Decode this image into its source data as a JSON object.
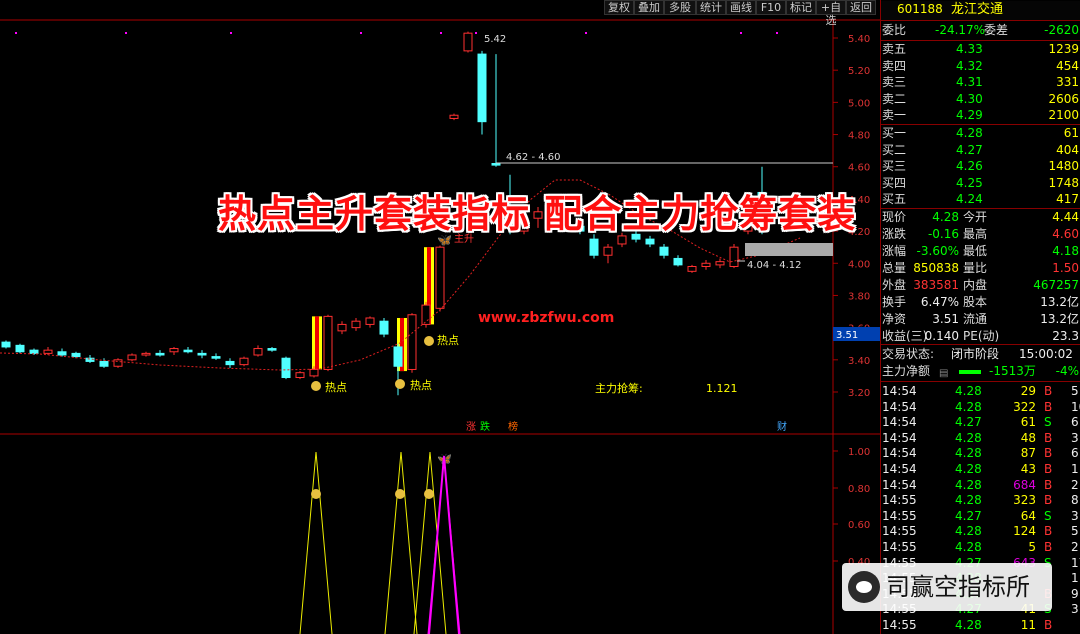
{
  "toolbar": {
    "buttons": [
      "复权",
      "叠加",
      "多股",
      "统计",
      "画线",
      "F10",
      "标记",
      "+自选",
      "返回"
    ]
  },
  "stock": {
    "code": "601188",
    "name": "龙江交通"
  },
  "order_book": {
    "weibi_label": "委比",
    "weibi": "-24.17%",
    "weicha_label": "委差",
    "weicha": "-2620",
    "asks": [
      {
        "label": "卖五",
        "price": "4.33",
        "vol": "1239"
      },
      {
        "label": "卖四",
        "price": "4.32",
        "vol": "454"
      },
      {
        "label": "卖三",
        "price": "4.31",
        "vol": "331"
      },
      {
        "label": "卖二",
        "price": "4.30",
        "vol": "2606"
      },
      {
        "label": "卖一",
        "price": "4.29",
        "vol": "2100"
      }
    ],
    "bids": [
      {
        "label": "买一",
        "price": "4.28",
        "vol": "61"
      },
      {
        "label": "买二",
        "price": "4.27",
        "vol": "404"
      },
      {
        "label": "买三",
        "price": "4.26",
        "vol": "1480"
      },
      {
        "label": "买四",
        "price": "4.25",
        "vol": "1748"
      },
      {
        "label": "买五",
        "price": "4.24",
        "vol": "417"
      }
    ]
  },
  "quote": [
    {
      "l1": "现价",
      "v1": "4.28",
      "l2": "今开",
      "v2": "4.44",
      "c1": "grn",
      "c2": "yel"
    },
    {
      "l1": "涨跌",
      "v1": "-0.16",
      "l2": "最高",
      "v2": "4.60",
      "c1": "grn",
      "c2": "red"
    },
    {
      "l1": "涨幅",
      "v1": "-3.60%",
      "l2": "最低",
      "v2": "4.18",
      "c1": "grn",
      "c2": "grn"
    },
    {
      "l1": "总量",
      "v1": "850838",
      "l2": "量比",
      "v2": "1.50",
      "c1": "yel",
      "c2": "red"
    },
    {
      "l1": "外盘",
      "v1": "383581",
      "l2": "内盘",
      "v2": "467257",
      "c1": "red",
      "c2": "grn"
    },
    {
      "l1": "换手",
      "v1": "6.47%",
      "l2": "股本",
      "v2": "13.2亿",
      "c1": "wht",
      "c2": "wht"
    },
    {
      "l1": "净资",
      "v1": "3.51",
      "l2": "流通",
      "v2": "13.2亿",
      "c1": "wht",
      "c2": "wht"
    },
    {
      "l1": "收益(三)",
      "v1": "0.140",
      "l2": "PE(动)",
      "v2": "23.3",
      "c1": "wht",
      "c2": "wht"
    }
  ],
  "trade_status": {
    "label": "交易状态:",
    "value": "闭市阶段",
    "time": "15:00:02"
  },
  "net_flow": {
    "label": "主力净额",
    "value": "-1513万",
    "pct": "-4%"
  },
  "ticks": [
    {
      "t": "14:54",
      "p": "4.28",
      "v": "29",
      "s": "B",
      "n": "5"
    },
    {
      "t": "14:54",
      "p": "4.28",
      "v": "322",
      "s": "B",
      "n": "10"
    },
    {
      "t": "14:54",
      "p": "4.27",
      "v": "61",
      "s": "S",
      "n": "6"
    },
    {
      "t": "14:54",
      "p": "4.28",
      "v": "48",
      "s": "B",
      "n": "3"
    },
    {
      "t": "14:54",
      "p": "4.28",
      "v": "87",
      "s": "B",
      "n": "6"
    },
    {
      "t": "14:54",
      "p": "4.28",
      "v": "43",
      "s": "B",
      "n": "1"
    },
    {
      "t": "14:54",
      "p": "4.28",
      "v": "684",
      "s": "B",
      "n": "2"
    },
    {
      "t": "14:55",
      "p": "4.28",
      "v": "323",
      "s": "B",
      "n": "8"
    },
    {
      "t": "14:55",
      "p": "4.27",
      "v": "64",
      "s": "S",
      "n": "3"
    },
    {
      "t": "14:55",
      "p": "4.28",
      "v": "124",
      "s": "B",
      "n": "5"
    },
    {
      "t": "14:55",
      "p": "4.28",
      "v": "5",
      "s": "B",
      "n": "2"
    },
    {
      "t": "14:55",
      "p": "4.27",
      "v": "643",
      "s": "S",
      "n": "17"
    },
    {
      "t": "14:55",
      "p": "4.28",
      "v": "",
      "s": "",
      "n": "1"
    },
    {
      "t": "14:55",
      "p": "4.27",
      "v": "",
      "s": "B",
      "n": "9"
    },
    {
      "t": "14:55",
      "p": "4.27",
      "v": "41",
      "s": "S",
      "n": "3"
    },
    {
      "t": "14:55",
      "p": "4.28",
      "v": "11",
      "s": "B",
      "n": ""
    }
  ],
  "banner": "热点主升套装指标 配合主力抢筹套装",
  "url": "www.zbzfwu.com",
  "watermark": "司赢空指标所",
  "chart_labels": {
    "high_label": "5.42",
    "range1": "4.62 - 4.60",
    "range2": "4.04 - 4.12",
    "hot1": "热点",
    "hot2": "热点",
    "hot3": "热点",
    "rise": "主升",
    "indicator_name": "主力抢筹:",
    "indicator_value": "1.121",
    "marker_zhang": "涨",
    "marker_die": "跌",
    "marker_bang": "榜",
    "marker_cai": "财",
    "price_tag": "3.51"
  },
  "chart_data": {
    "type": "candlestick",
    "yticks_main": [
      "5.40",
      "5.20",
      "5.00",
      "4.80",
      "4.60",
      "4.40",
      "4.20",
      "4.00",
      "3.80",
      "3.60",
      "3.40",
      "3.20"
    ],
    "yticks_sub": [
      "1.00",
      "0.80",
      "0.60",
      "0.40"
    ],
    "candles": [
      {
        "o": 3.51,
        "c": 3.48,
        "h": 3.52,
        "l": 3.47
      },
      {
        "o": 3.49,
        "c": 3.45,
        "h": 3.5,
        "l": 3.44
      },
      {
        "o": 3.46,
        "c": 3.44,
        "h": 3.47,
        "l": 3.43
      },
      {
        "o": 3.44,
        "c": 3.46,
        "h": 3.48,
        "l": 3.43
      },
      {
        "o": 3.45,
        "c": 3.43,
        "h": 3.47,
        "l": 3.42
      },
      {
        "o": 3.44,
        "c": 3.42,
        "h": 3.45,
        "l": 3.41
      },
      {
        "o": 3.41,
        "c": 3.39,
        "h": 3.43,
        "l": 3.38
      },
      {
        "o": 3.39,
        "c": 3.36,
        "h": 3.41,
        "l": 3.35
      },
      {
        "o": 3.36,
        "c": 3.4,
        "h": 3.41,
        "l": 3.35
      },
      {
        "o": 3.4,
        "c": 3.43,
        "h": 3.44,
        "l": 3.39
      },
      {
        "o": 3.43,
        "c": 3.44,
        "h": 3.45,
        "l": 3.42
      },
      {
        "o": 3.44,
        "c": 3.43,
        "h": 3.46,
        "l": 3.42
      },
      {
        "o": 3.45,
        "c": 3.47,
        "h": 3.48,
        "l": 3.43
      },
      {
        "o": 3.46,
        "c": 3.45,
        "h": 3.48,
        "l": 3.44
      },
      {
        "o": 3.44,
        "c": 3.43,
        "h": 3.46,
        "l": 3.41
      },
      {
        "o": 3.42,
        "c": 3.41,
        "h": 3.44,
        "l": 3.4
      },
      {
        "o": 3.39,
        "c": 3.37,
        "h": 3.41,
        "l": 3.35
      },
      {
        "o": 3.37,
        "c": 3.41,
        "h": 3.42,
        "l": 3.36
      },
      {
        "o": 3.43,
        "c": 3.47,
        "h": 3.49,
        "l": 3.42
      },
      {
        "o": 3.47,
        "c": 3.46,
        "h": 3.48,
        "l": 3.45
      },
      {
        "o": 3.41,
        "c": 3.29,
        "h": 3.42,
        "l": 3.28
      },
      {
        "o": 3.29,
        "c": 3.32,
        "h": 3.33,
        "l": 3.28
      },
      {
        "o": 3.3,
        "c": 3.34,
        "h": 3.36,
        "l": 3.29
      },
      {
        "o": 3.34,
        "c": 3.67,
        "h": 3.68,
        "l": 3.33
      },
      {
        "o": 3.58,
        "c": 3.62,
        "h": 3.64,
        "l": 3.56
      },
      {
        "o": 3.6,
        "c": 3.64,
        "h": 3.66,
        "l": 3.58
      },
      {
        "o": 3.62,
        "c": 3.66,
        "h": 3.67,
        "l": 3.6
      },
      {
        "o": 3.64,
        "c": 3.56,
        "h": 3.66,
        "l": 3.54
      },
      {
        "o": 3.48,
        "c": 3.36,
        "h": 3.5,
        "l": 3.18
      },
      {
        "o": 3.34,
        "c": 3.68,
        "h": 3.69,
        "l": 3.32
      },
      {
        "o": 3.62,
        "c": 3.74,
        "h": 3.76,
        "l": 3.6
      },
      {
        "o": 3.72,
        "c": 4.1,
        "h": 4.11,
        "l": 3.7
      },
      {
        "o": 4.9,
        "c": 4.92,
        "h": 4.93,
        "l": 4.89
      },
      {
        "o": 5.32,
        "c": 5.43,
        "h": 5.44,
        "l": 5.31
      },
      {
        "o": 5.3,
        "c": 4.88,
        "h": 5.32,
        "l": 4.8
      },
      {
        "o": 4.62,
        "c": 4.61,
        "h": 5.3,
        "l": 4.6
      },
      {
        "o": 4.3,
        "c": 4.26,
        "h": 4.55,
        "l": 4.18
      },
      {
        "o": 4.2,
        "c": 4.26,
        "h": 4.3,
        "l": 4.18
      },
      {
        "o": 4.28,
        "c": 4.32,
        "h": 4.35,
        "l": 4.22
      },
      {
        "o": 4.35,
        "c": 4.33,
        "h": 4.38,
        "l": 4.3
      },
      {
        "o": 4.3,
        "c": 4.27,
        "h": 4.34,
        "l": 4.25
      },
      {
        "o": 4.23,
        "c": 4.2,
        "h": 4.26,
        "l": 4.18
      },
      {
        "o": 4.15,
        "c": 4.05,
        "h": 4.18,
        "l": 4.03
      },
      {
        "o": 4.05,
        "c": 4.1,
        "h": 4.12,
        "l": 4.0
      },
      {
        "o": 4.12,
        "c": 4.17,
        "h": 4.19,
        "l": 4.1
      },
      {
        "o": 4.18,
        "c": 4.15,
        "h": 4.2,
        "l": 4.13
      },
      {
        "o": 4.15,
        "c": 4.12,
        "h": 4.17,
        "l": 4.1
      },
      {
        "o": 4.1,
        "c": 4.05,
        "h": 4.12,
        "l": 4.03
      },
      {
        "o": 4.03,
        "c": 3.99,
        "h": 4.05,
        "l": 3.98
      },
      {
        "o": 3.95,
        "c": 3.98,
        "h": 3.99,
        "l": 3.94
      },
      {
        "o": 3.98,
        "c": 4.0,
        "h": 4.02,
        "l": 3.96
      },
      {
        "o": 3.99,
        "c": 4.01,
        "h": 4.03,
        "l": 3.97
      },
      {
        "o": 3.98,
        "c": 4.1,
        "h": 4.12,
        "l": 3.97
      },
      {
        "o": 4.2,
        "c": 4.28,
        "h": 4.44,
        "l": 4.18
      },
      {
        "o": 4.44,
        "c": 4.28,
        "h": 4.6,
        "l": 4.18
      }
    ]
  }
}
